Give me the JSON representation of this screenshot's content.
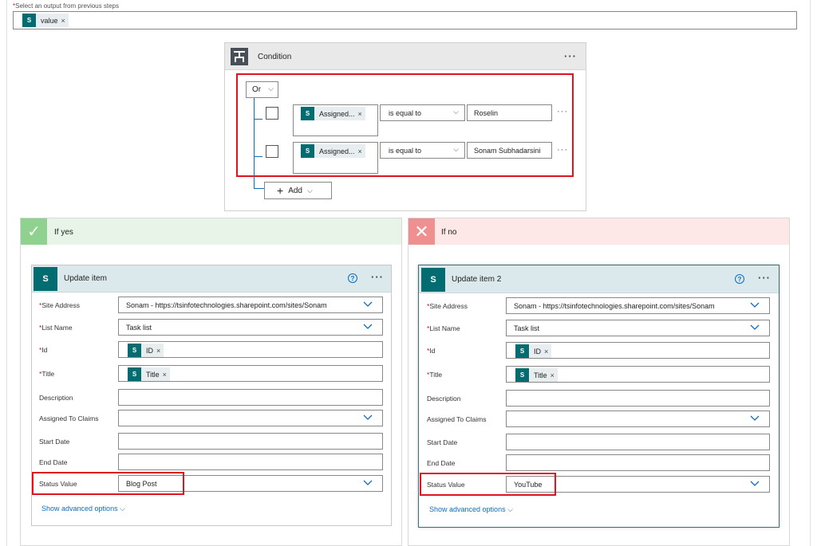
{
  "top_output": {
    "required_mark": "*",
    "label": "Select an output from previous steps",
    "token": {
      "icon": "sharepoint-icon",
      "icon_text": "S",
      "label": "value",
      "remove": "×"
    }
  },
  "condition": {
    "title": "Condition",
    "menu": "···",
    "group_operator": "Or",
    "chevron": "⌵",
    "rows": [
      {
        "operand": "Assigned...",
        "remove": "×",
        "operator": "is equal to",
        "value": "Roselin",
        "menu": "···"
      },
      {
        "operand": "Assigned...",
        "remove": "×",
        "operator": "is equal to",
        "value": "Sonam Subhadarsini",
        "menu": "···"
      }
    ],
    "add_button": {
      "plus": "+",
      "label": "Add",
      "chevron": "⌵"
    }
  },
  "branches": {
    "yes": {
      "title": "If yes",
      "icon": "✓",
      "header_color": "#e8f4e8",
      "action": {
        "title": "Update item",
        "help": "?",
        "menu": "···",
        "icon_text": "S",
        "fields": [
          {
            "label": "Site Address",
            "required": "*",
            "value": "Sonam - https://tsinfotechnologies.sharepoint.com/sites/Sonam",
            "dropdown": true
          },
          {
            "label": "List Name",
            "required": "*",
            "value": "Task list",
            "dropdown": true
          },
          {
            "label": "Id",
            "required": "*",
            "token": "ID",
            "remove": "×"
          },
          {
            "label": "Title",
            "required": "*",
            "token": "Title",
            "remove": "×"
          },
          {
            "label": "Description",
            "required": "",
            "value": ""
          },
          {
            "label": "Assigned To Claims",
            "required": "",
            "value": "",
            "dropdown": true
          },
          {
            "label": "Start Date",
            "required": "",
            "value": ""
          },
          {
            "label": "End Date",
            "required": "",
            "value": ""
          },
          {
            "label": "Status Value",
            "required": "",
            "value": "Blog Post",
            "dropdown": true,
            "highlight": true
          }
        ],
        "advanced": "Show advanced options",
        "advanced_chevron": "⌵"
      }
    },
    "no": {
      "title": "If no",
      "icon": "✕",
      "header_color": "#fde7e7",
      "action": {
        "title": "Update item 2",
        "help": "?",
        "menu": "···",
        "icon_text": "S",
        "fields": [
          {
            "label": "Site Address",
            "required": "*",
            "value": "Sonam - https://tsinfotechnologies.sharepoint.com/sites/Sonam",
            "dropdown": true
          },
          {
            "label": "List Name",
            "required": "*",
            "value": "Task list",
            "dropdown": true
          },
          {
            "label": "Id",
            "required": "*",
            "token": "ID",
            "remove": "×"
          },
          {
            "label": "Title",
            "required": "*",
            "token": "Title",
            "remove": "×"
          },
          {
            "label": "Description",
            "required": "",
            "value": ""
          },
          {
            "label": "Assigned To Claims",
            "required": "",
            "value": "",
            "dropdown": true
          },
          {
            "label": "Start Date",
            "required": "",
            "value": ""
          },
          {
            "label": "End Date",
            "required": "",
            "value": ""
          },
          {
            "label": "Status Value",
            "required": "",
            "value": "YouTube",
            "dropdown": true,
            "highlight": true
          }
        ],
        "advanced": "Show advanced options",
        "advanced_chevron": "⌵"
      }
    }
  },
  "colors": {
    "accent": "#0f6cbd",
    "sharepoint": "#036c70",
    "highlight": "#e0141e"
  }
}
